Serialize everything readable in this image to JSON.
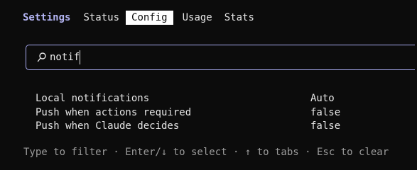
{
  "tabs": {
    "title": "Settings",
    "items": [
      "Status",
      "Config",
      "Usage",
      "Stats"
    ],
    "active": "Config"
  },
  "search": {
    "value": "notif",
    "icon": "search-icon"
  },
  "settings": [
    {
      "label": "Local notifications",
      "value": "Auto"
    },
    {
      "label": "Push when actions required",
      "value": "false"
    },
    {
      "label": "Push when Claude decides",
      "value": "false"
    }
  ],
  "footer": {
    "hint": "Type to filter · Enter/↓ to select · ↑ to tabs · Esc to clear"
  },
  "colors": {
    "accent": "#b3b4f2",
    "background": "#0c0c0c",
    "muted": "#9c9c9c"
  }
}
